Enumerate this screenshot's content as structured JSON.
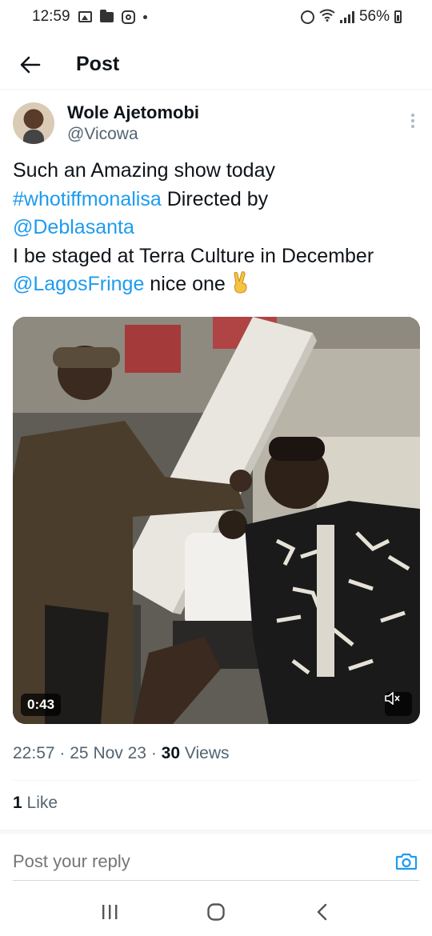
{
  "status_bar": {
    "time": "12:59",
    "battery": "56%",
    "left_icons": [
      "gallery-icon",
      "folder-icon",
      "instagram-icon",
      "dot-icon"
    ],
    "right_icons": [
      "alarm-icon",
      "wifi-icon",
      "signal-icon",
      "battery-icon"
    ]
  },
  "header": {
    "back_icon": "arrow-left-icon",
    "title": "Post"
  },
  "post": {
    "author_name": "Wole Ajetomobi",
    "author_handle": "@Vicowa",
    "text": {
      "line1": "Such an Amazing show today",
      "hashtag": "#whotiffmonalisa",
      "line2_rest": " Directed by",
      "mention1": "@Deblasanta",
      "line4": "I be staged at Terra Culture in December",
      "mention2": "@LagosFringe",
      "line5_rest": " nice one"
    },
    "emoji": "victory-hand-emoji",
    "video": {
      "duration": "0:43",
      "mute_icon": "muted-speaker-icon"
    },
    "time": "22:57",
    "separator": "·",
    "date": "25 Nov 23",
    "views_count": "30",
    "views_label": " Views",
    "likes_count": "1",
    "likes_label": " Like"
  },
  "reply": {
    "placeholder": "Post your reply",
    "camera_icon": "camera-icon"
  },
  "nav_bar": {
    "icons": [
      "recent-apps-icon",
      "home-icon",
      "back-icon"
    ]
  },
  "colors": {
    "link": "#1d9bf0",
    "secondary_text": "#536471",
    "primary_text": "#0f1419"
  }
}
